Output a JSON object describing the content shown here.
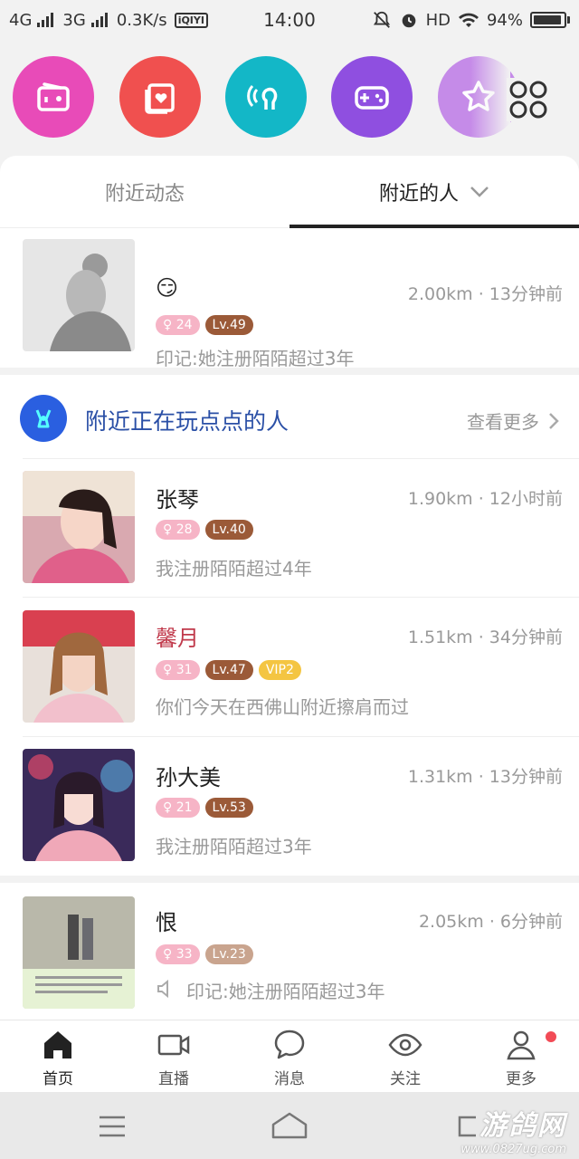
{
  "status_bar": {
    "net1": "4G",
    "net2": "3G",
    "speed": "0.3K/s",
    "app_badge": "iQIYI",
    "time": "14:00",
    "hd": "HD",
    "battery": "94%",
    "battery_level": 0.94
  },
  "top_icons": [
    {
      "name": "radio-icon",
      "color": "#e84bb8"
    },
    {
      "name": "photo-card-icon",
      "color": "#f0504f"
    },
    {
      "name": "voice-chat-icon",
      "color": "#13b7c7"
    },
    {
      "name": "gamepad-icon",
      "color": "#8f4fe0"
    },
    {
      "name": "star-icon",
      "color": "#c58be8"
    },
    {
      "name": "more-apps-grid-icon",
      "color": "#333333"
    }
  ],
  "tabs": {
    "left": "附近动态",
    "right": "附近的人"
  },
  "first_user": {
    "name": "😏",
    "distance_time": "2.00km · 13分钟前",
    "likes": "24",
    "level": "Lv.49",
    "subtitle": "印记:她注册陌陌超过3年"
  },
  "section": {
    "title": "附近正在玩点点的人",
    "more": "查看更多"
  },
  "users": [
    {
      "name": "张琴",
      "name_color": "#222222",
      "distance_time": "1.90km · 12小时前",
      "likes": "28",
      "level": "Lv.40",
      "vip": "",
      "subtitle": "我注册陌陌超过4年"
    },
    {
      "name": "馨月",
      "name_color": "#c0394b",
      "distance_time": "1.51km · 34分钟前",
      "likes": "31",
      "level": "Lv.47",
      "vip": "VIP2",
      "subtitle": "你们今天在西佛山附近擦肩而过"
    },
    {
      "name": "孙大美",
      "name_color": "#222222",
      "distance_time": "1.31km · 13分钟前",
      "likes": "21",
      "level": "Lv.53",
      "vip": "",
      "subtitle": "我注册陌陌超过3年"
    }
  ],
  "last_user": {
    "name": "恨",
    "distance_time": "2.05km · 6分钟前",
    "likes": "33",
    "level": "Lv.23",
    "subtitle": "印记:她注册陌陌超过3年"
  },
  "bottom_nav": [
    {
      "label": "首页",
      "icon": "home-icon"
    },
    {
      "label": "直播",
      "icon": "video-camera-icon"
    },
    {
      "label": "消息",
      "icon": "chat-bubble-icon"
    },
    {
      "label": "关注",
      "icon": "eye-icon"
    },
    {
      "label": "更多",
      "icon": "person-icon"
    }
  ],
  "watermark": {
    "big": "游鸽网",
    "small": "www.0827ug.com"
  }
}
